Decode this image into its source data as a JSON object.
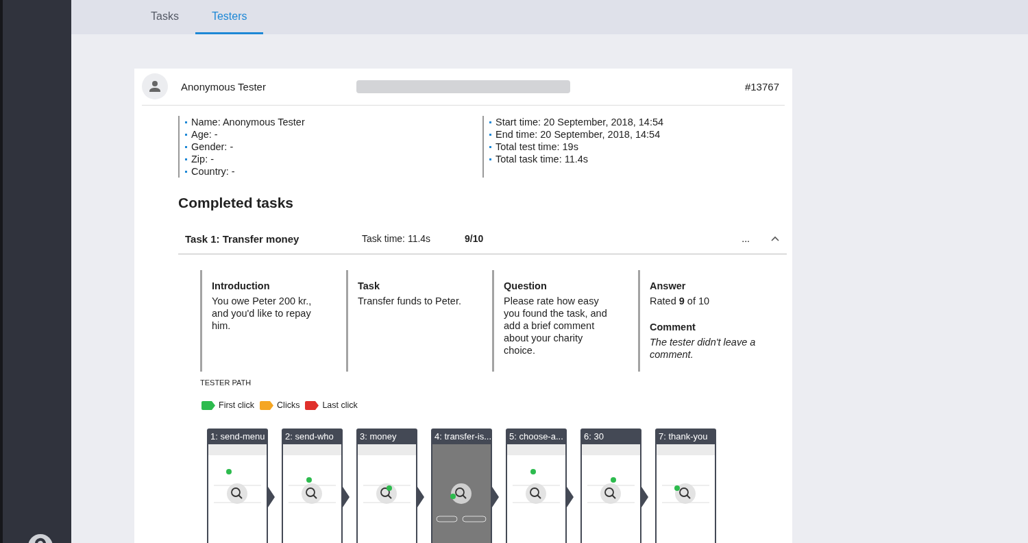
{
  "tabs": [
    {
      "label": "Tasks",
      "selected": false
    },
    {
      "label": "Testers",
      "selected": true
    }
  ],
  "tester": {
    "name": "Anonymous Tester",
    "id": "#13767"
  },
  "details_left": [
    "Name: Anonymous Tester",
    "Age: -",
    "Gender: -",
    "Zip: -",
    "Country: -"
  ],
  "details_right": [
    "Start time: 20 September, 2018, 14:54",
    "End time: 20 September, 2018, 14:54",
    "Total test time: 19s",
    "Total task time: 11.4s"
  ],
  "section_title": "Completed tasks",
  "task": {
    "title": "Task 1: Transfer money",
    "time": "Task time: 11.4s",
    "score": "9/10",
    "menu": "...",
    "expanded": true,
    "columns": [
      {
        "kind": "text",
        "heading": "Introduction",
        "text": "You owe Peter 200 kr., and you'd like to repay him."
      },
      {
        "kind": "text",
        "heading": "Task",
        "text": "Transfer funds to Peter."
      },
      {
        "kind": "text",
        "heading": "Question",
        "text": "Please rate how easy you found the task, and add a brief comment about your charity choice."
      },
      {
        "kind": "answer",
        "heading": "Answer",
        "text": "Rated **9** of 10",
        "comment_heading": "Comment",
        "comment": "The tester didn't leave a comment."
      }
    ]
  },
  "path": {
    "title": "TESTER PATH",
    "legend": [
      {
        "label": "First click",
        "color": "#2dbb4e"
      },
      {
        "label": "Clicks",
        "color": "#f5a623"
      },
      {
        "label": "Last click",
        "color": "#e0302b"
      }
    ],
    "screens": [
      {
        "title": "1: send-menu",
        "kind": "light"
      },
      {
        "title": "2: send-who",
        "kind": "light"
      },
      {
        "title": "3: money",
        "kind": "light"
      },
      {
        "title": "4: transfer-is...",
        "kind": "dark"
      },
      {
        "title": "5: choose-a...",
        "kind": "light"
      },
      {
        "title": "6: 30",
        "kind": "light"
      },
      {
        "title": "7: thank-you",
        "kind": "light"
      }
    ]
  }
}
